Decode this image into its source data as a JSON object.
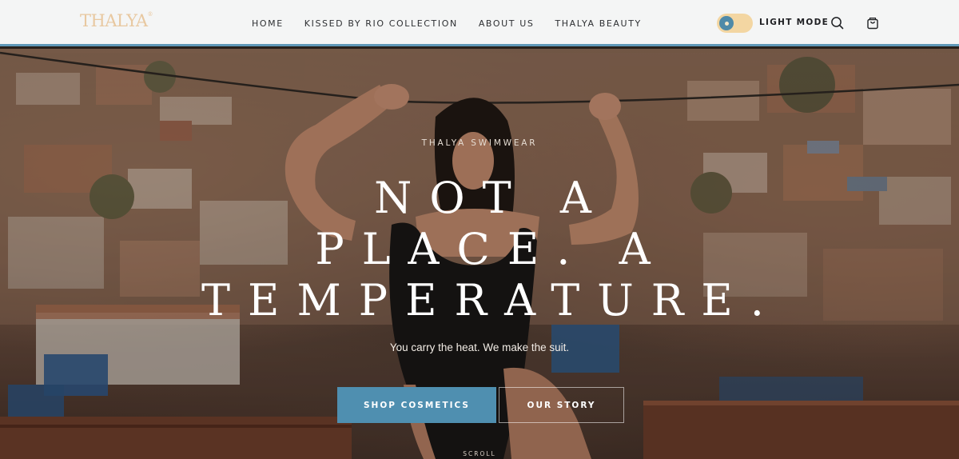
{
  "brand": {
    "logo_text": "THALYA",
    "logo_mark": "®",
    "logo_color": "#e8c8a0"
  },
  "nav": {
    "items": [
      "HOME",
      "KISSED BY RIO COLLECTION",
      "ABOUT US",
      "THALYA BEAUTY"
    ]
  },
  "header": {
    "mode_label": "LIGHT MODE",
    "search_icon": "search-icon",
    "cart_icon": "shopping-bag-icon",
    "accent_color": "#5f98b8"
  },
  "hero": {
    "eyebrow": "THALYA SWIMWEAR",
    "headline_lines": [
      "NOT A",
      "PLACE. A",
      "TEMPERATURE."
    ],
    "subtitle": "You carry the heat. We make the suit.",
    "primary_cta": "SHOP COSMETICS",
    "secondary_cta": "OUR STORY",
    "scroll_label": "SCROLL",
    "primary_color": "#4f8fb0"
  }
}
